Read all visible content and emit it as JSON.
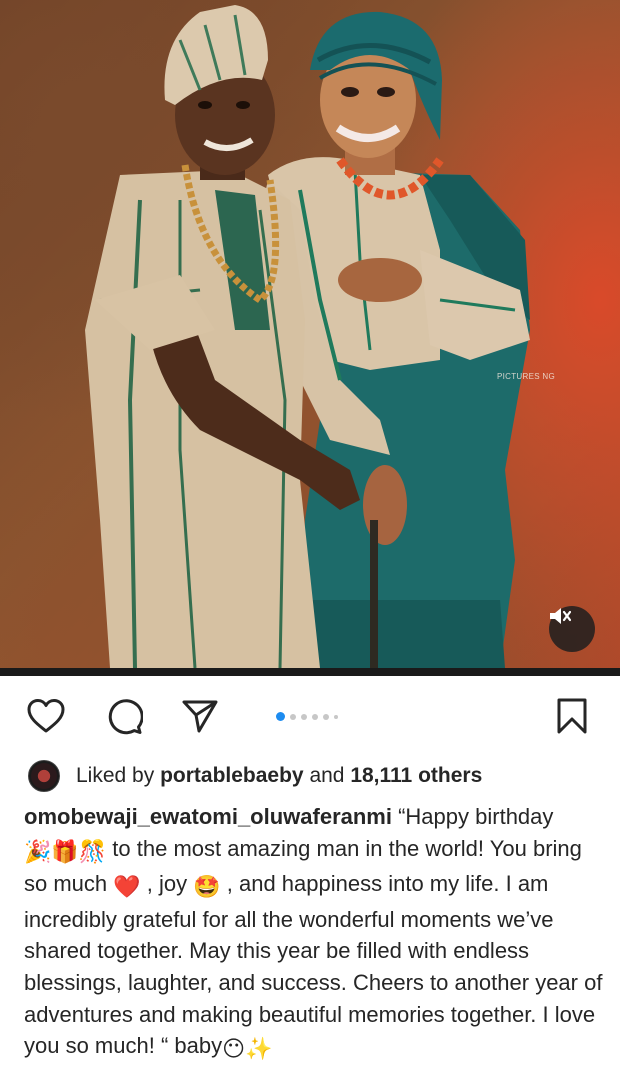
{
  "post": {
    "watermark": "PICTURES NG",
    "media_indicator": {
      "total": 7,
      "active_index": 0
    },
    "mute_icon": "speaker-muted-icon"
  },
  "actions": {
    "like_icon": "heart-icon",
    "comment_icon": "comment-bubble-icon",
    "share_icon": "paper-plane-icon",
    "save_icon": "bookmark-icon"
  },
  "likes": {
    "prefix": "Liked by ",
    "user": "portablebaeby",
    "middle": " and ",
    "count": "18,111 others"
  },
  "caption": {
    "username": "omobewaji_ewatomi_oluwaferanmi",
    "text_1": " “Happy birthday ",
    "emoji_1": "🎉🎁🎊",
    "text_2": " to the most amazing man in the world! You bring so much ",
    "emoji_heart": "❤️",
    "text_3": " , joy ",
    "emoji_joy": "🤩",
    "text_4": " , and happiness into my life. I am incredibly grateful for all the wonderful moments we’ve shared together. May this year be filled with endless blessings, laughter, and success. Cheers to another year of adventures and making beautiful memories together. I love you so much! “ baby",
    "emoji_end": "😶✨"
  },
  "colors": {
    "accent_blue": "#1d8cf0",
    "heart_red": "#e0245e",
    "text": "#262626"
  }
}
